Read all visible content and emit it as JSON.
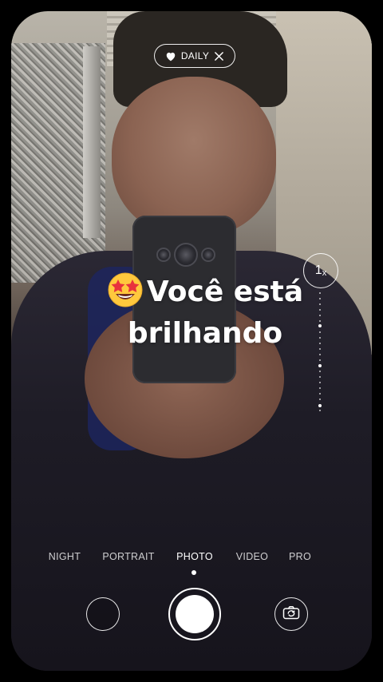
{
  "daily_badge": {
    "label": "DAILY",
    "icon": "heart-icon",
    "close_icon": "close-icon"
  },
  "caption": {
    "emoji": "star-struck-emoji",
    "text": "Você está brilhando"
  },
  "zoom": {
    "label": "1x",
    "value": "1",
    "unit": "x"
  },
  "modes": [
    {
      "label": "NIGHT"
    },
    {
      "label": "PORTRAIT"
    },
    {
      "label": "PHOTO"
    },
    {
      "label": "VIDEO"
    },
    {
      "label": "PRO"
    }
  ],
  "active_mode": "PHOTO",
  "controls": {
    "gallery_icon": "gallery-thumbnail",
    "shutter_icon": "shutter-icon",
    "flip_icon": "flip-camera-icon"
  },
  "colors": {
    "overlay": "#ffffff",
    "background": "#000000"
  }
}
